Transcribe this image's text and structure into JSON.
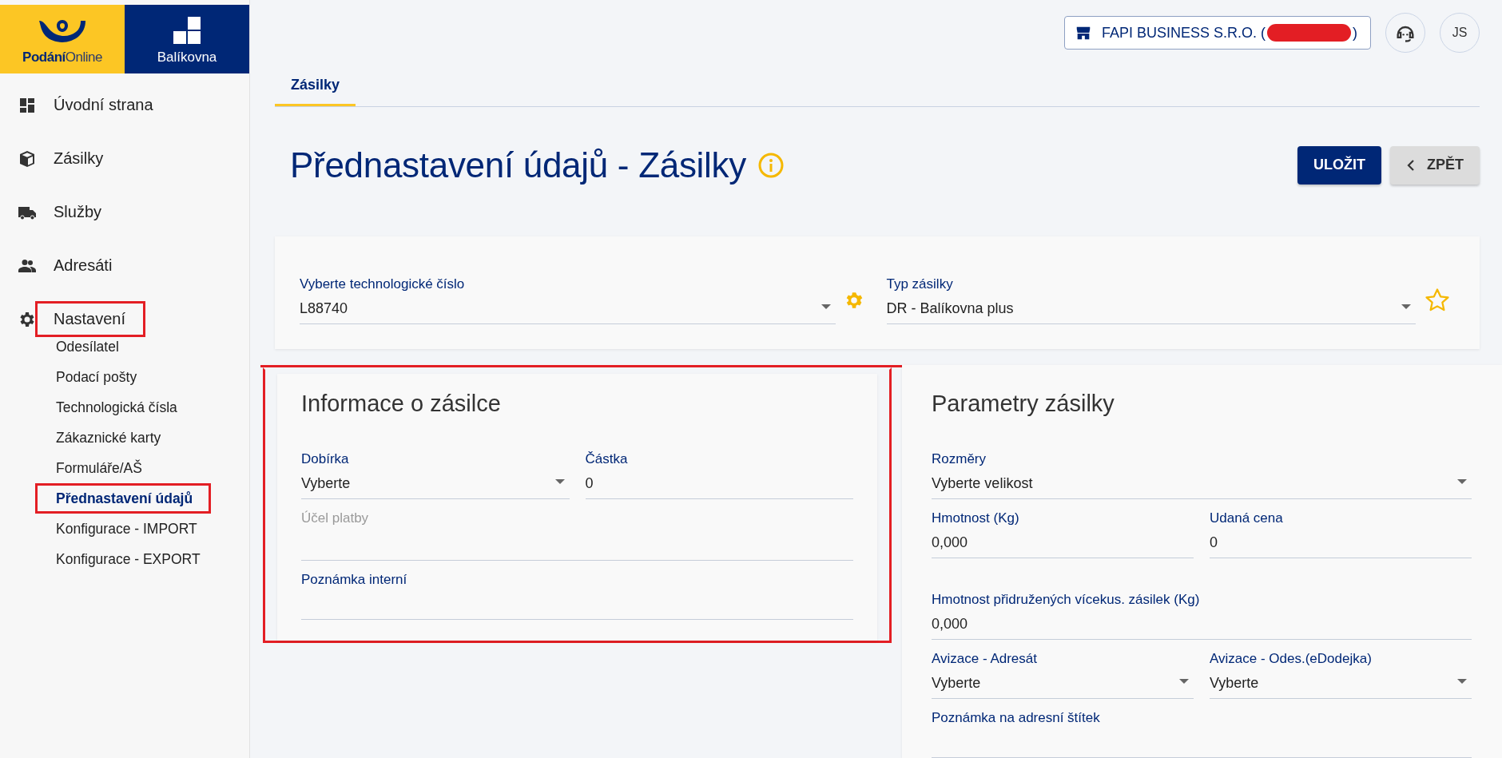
{
  "logo": {
    "primary_bold_part": "Podání",
    "primary_light_part": "Online",
    "secondary": "Balíkovna"
  },
  "sidebar": {
    "items": [
      {
        "label": "Úvodní strana",
        "selected": false,
        "annotated": false
      },
      {
        "label": "Zásilky",
        "selected": false,
        "annotated": false
      },
      {
        "label": "Služby",
        "selected": false,
        "annotated": false
      },
      {
        "label": "Adresáti",
        "selected": false,
        "annotated": false
      },
      {
        "label": "Nastavení",
        "selected": false,
        "annotated": true,
        "children": [
          {
            "label": "Odesílatel",
            "selected": false,
            "annotated": false
          },
          {
            "label": "Podací pošty",
            "selected": false,
            "annotated": false
          },
          {
            "label": "Technologická čísla",
            "selected": false,
            "annotated": false
          },
          {
            "label": "Zákaznické karty",
            "selected": false,
            "annotated": false
          },
          {
            "label": "Formuláře/AŠ",
            "selected": false,
            "annotated": false
          },
          {
            "label": "Přednastavení údajů",
            "selected": true,
            "annotated": true
          },
          {
            "label": "Konfigurace - IMPORT",
            "selected": false,
            "annotated": false
          },
          {
            "label": "Konfigurace - EXPORT",
            "selected": false,
            "annotated": false
          }
        ]
      }
    ]
  },
  "header": {
    "company": {
      "name_start": "FAPI BUSINESS S.R.O. (",
      "redacted": true,
      "name_end": ")"
    },
    "avatar": "JS"
  },
  "tabs": [
    {
      "label": "Zásilky",
      "selected": true
    }
  ],
  "page": {
    "title": "Přednastavení údajů - Zásilky",
    "buttons": [
      {
        "label": "ULOŽIT",
        "kind": "primary"
      },
      {
        "label": "ZPĚT",
        "kind": "back"
      }
    ]
  },
  "selection_card": {
    "fields": [
      {
        "label": "Vyberte technologické číslo",
        "value": "L88740",
        "kind": "select"
      },
      {
        "label": "Typ zásilky",
        "value": "DR - Balíkovna plus",
        "kind": "select",
        "favorite": false
      }
    ]
  },
  "info_card": {
    "title": "Informace o zásilce",
    "annotated": true,
    "rows": [
      [
        {
          "label": "Dobírka",
          "value": "Vyberte",
          "kind": "select"
        },
        {
          "label": "Částka",
          "value": "0",
          "kind": "text"
        }
      ],
      [
        {
          "placeholder": "Účel platby",
          "kind": "text"
        }
      ],
      [
        {
          "label": "Poznámka interní",
          "kind": "text"
        }
      ]
    ]
  },
  "params_card": {
    "title": "Parametry zásilky",
    "rows": [
      [
        {
          "label": "Rozměry",
          "value": "Vyberte velikost",
          "kind": "select"
        }
      ],
      [
        {
          "label": "Hmotnost (Kg)",
          "value": "0,000",
          "kind": "text"
        },
        {
          "label": "Udaná cena",
          "value": "0",
          "kind": "text"
        }
      ],
      [
        {
          "label": "Hmotnost přidružených vícekus. zásilek (Kg)",
          "value": "0,000",
          "kind": "text"
        }
      ],
      [
        {
          "label": "Avizace - Adresát",
          "value": "Vyberte",
          "kind": "select"
        },
        {
          "label": "Avizace - Odes.(eDodejka)",
          "value": "Vyberte",
          "kind": "select"
        }
      ],
      [
        {
          "label": "Poznámka na adresní štítek",
          "kind": "text"
        }
      ]
    ]
  }
}
